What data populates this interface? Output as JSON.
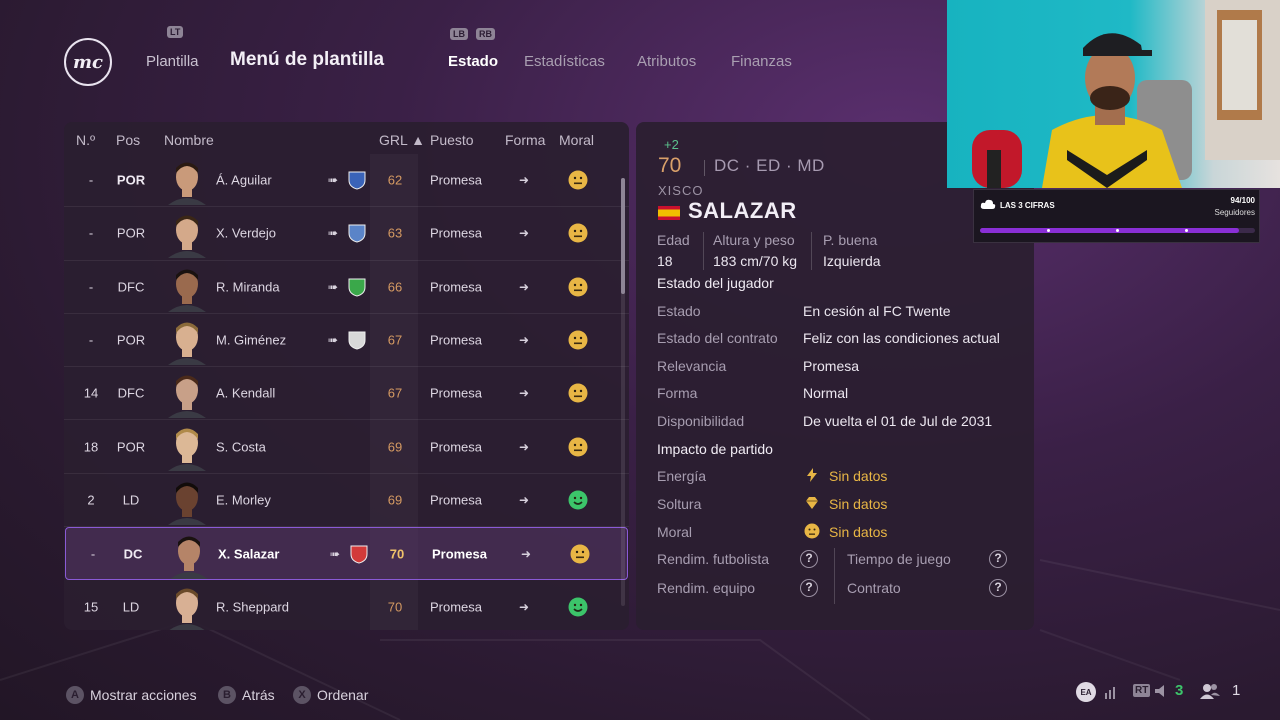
{
  "header": {
    "logo_text": "mc",
    "hint_lt": "LT",
    "hint_lb": "LB",
    "hint_rb": "RB",
    "nav_plantilla": "Plantilla",
    "title": "Menú de plantilla",
    "tabs": [
      {
        "label": "Estado",
        "active": true
      },
      {
        "label": "Estadísticas",
        "active": false
      },
      {
        "label": "Atributos",
        "active": false
      },
      {
        "label": "Finanzas",
        "active": false
      }
    ]
  },
  "table": {
    "columns": {
      "num": "N.º",
      "pos": "Pos",
      "name": "Nombre",
      "grl": "GRL ▲",
      "puesto": "Puesto",
      "forma": "Forma",
      "moral": "Moral"
    },
    "rows": [
      {
        "num": "-",
        "pos": "POR",
        "name": "Á. Aguilar",
        "grl": "62",
        "puesto": "Promesa",
        "forma": "➜",
        "moral": "neutral",
        "loan": true,
        "crest": "#3a63b8",
        "pos_bold": true,
        "skin": "#c99a7a",
        "hair": "#2a1a12",
        "selected": false
      },
      {
        "num": "-",
        "pos": "POR",
        "name": "X. Verdejo",
        "grl": "63",
        "puesto": "Promesa",
        "forma": "➜",
        "moral": "neutral",
        "loan": true,
        "crest": "#5a84c8",
        "pos_bold": false,
        "skin": "#d4a98a",
        "hair": "#3a2616",
        "selected": false
      },
      {
        "num": "-",
        "pos": "DFC",
        "name": "R. Miranda",
        "grl": "66",
        "puesto": "Promesa",
        "forma": "➜",
        "moral": "neutral",
        "loan": true,
        "crest": "#3aa84a",
        "pos_bold": false,
        "skin": "#9a6a4e",
        "hair": "#1a1210",
        "selected": false
      },
      {
        "num": "-",
        "pos": "POR",
        "name": "M. Giménez",
        "grl": "67",
        "puesto": "Promesa",
        "forma": "➜",
        "moral": "neutral",
        "loan": true,
        "crest": "#d8d8d8",
        "pos_bold": false,
        "skin": "#d8b090",
        "hair": "#8a6a3a",
        "selected": false
      },
      {
        "num": "14",
        "pos": "DFC",
        "name": "A. Kendall",
        "grl": "67",
        "puesto": "Promesa",
        "forma": "➜",
        "moral": "neutral",
        "loan": false,
        "crest": "",
        "pos_bold": false,
        "skin": "#c8a088",
        "hair": "#4a2a1a",
        "selected": false
      },
      {
        "num": "18",
        "pos": "POR",
        "name": "S. Costa",
        "grl": "69",
        "puesto": "Promesa",
        "forma": "➜",
        "moral": "neutral",
        "loan": false,
        "crest": "",
        "pos_bold": false,
        "skin": "#dcb896",
        "hair": "#b08a4a",
        "selected": false
      },
      {
        "num": "2",
        "pos": "LD",
        "name": "E. Morley",
        "grl": "69",
        "puesto": "Promesa",
        "forma": "➜",
        "moral": "happy",
        "loan": false,
        "crest": "",
        "pos_bold": false,
        "skin": "#6a4230",
        "hair": "#120c0a",
        "selected": false
      },
      {
        "num": "-",
        "pos": "DC",
        "name": "X. Salazar",
        "grl": "70",
        "puesto": "Promesa",
        "forma": "➜",
        "moral": "neutral",
        "loan": true,
        "crest": "#d23a3a",
        "pos_bold": false,
        "skin": "#b58468",
        "hair": "#1a1210",
        "selected": true
      },
      {
        "num": "15",
        "pos": "LD",
        "name": "R. Sheppard",
        "grl": "70",
        "puesto": "Promesa",
        "forma": "➜",
        "moral": "happy",
        "loan": false,
        "crest": "",
        "pos_bold": false,
        "skin": "#d8b094",
        "hair": "#6a4a2a",
        "selected": false
      }
    ]
  },
  "player": {
    "rating_change": "+2",
    "rating": "70",
    "positions": "DC · ED · MD",
    "first_name": "XISCO",
    "last_name": "SALAZAR",
    "labels": {
      "edad": "Edad",
      "altura": "Altura y peso",
      "pie": "P. buena"
    },
    "values": {
      "edad": "18",
      "altura": "183 cm/70 kg",
      "pie": "Izquierda"
    },
    "status_heading": "Estado del jugador",
    "status": [
      {
        "label": "Estado",
        "value": "En cesión al FC Twente"
      },
      {
        "label": "Estado del contrato",
        "value": "Feliz con las condiciones actual"
      },
      {
        "label": "Relevancia",
        "value": "Promesa"
      },
      {
        "label": "Forma",
        "value": "Normal"
      },
      {
        "label": "Disponibilidad",
        "value": "De vuelta el 01 de Jul de 2031"
      }
    ],
    "impact_heading": "Impacto de partido",
    "impact": [
      {
        "label": "Energía",
        "value": "Sin datos",
        "icon": "lightning-icon"
      },
      {
        "label": "Soltura",
        "value": "Sin datos",
        "icon": "diamond-icon"
      },
      {
        "label": "Moral",
        "value": "Sin datos",
        "icon": "face-icon"
      }
    ],
    "extras": {
      "rend_futbolista": "Rendim. futbolista",
      "tiempo_juego": "Tiempo de juego",
      "rend_equipo": "Rendim. equipo",
      "contrato": "Contrato",
      "qmark": "?"
    }
  },
  "stream_overlay": {
    "title": "LAS 3 CIFRAS",
    "count": "94/100",
    "sub": "Seguidores",
    "progress": 0.94
  },
  "footer": {
    "actions": [
      {
        "key": "A",
        "label": "Mostrar acciones"
      },
      {
        "key": "B",
        "label": "Atrás"
      },
      {
        "key": "X",
        "label": "Ordenar"
      }
    ],
    "sys": {
      "ea": "EA",
      "rt": "RT",
      "count_green": "3",
      "count_users": "1"
    }
  },
  "colors": {
    "accent": "#8a5ad6",
    "grl": "#d59a62",
    "happy": "#3cc46a",
    "neutral": "#e8b645"
  }
}
